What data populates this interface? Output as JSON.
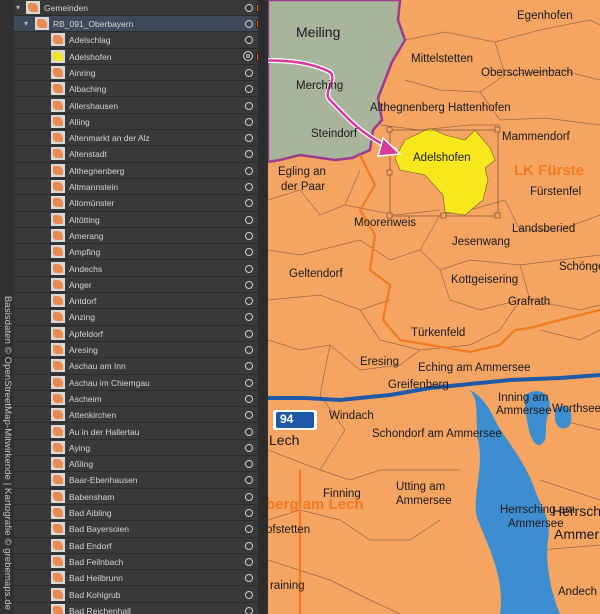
{
  "layers": {
    "root_label": "Gemeinden",
    "group_label": "RB_091_Oberbayern",
    "items": [
      {
        "label": "Adelschlag"
      },
      {
        "label": "Adelshofen",
        "highlight": true
      },
      {
        "label": "Ainring"
      },
      {
        "label": "Albaching"
      },
      {
        "label": "Allershausen"
      },
      {
        "label": "Alling"
      },
      {
        "label": "Altenmarkt an der Alz"
      },
      {
        "label": "Altenstadt"
      },
      {
        "label": "Althegnenberg"
      },
      {
        "label": "Altmannstein"
      },
      {
        "label": "Altomünster"
      },
      {
        "label": "Altötting"
      },
      {
        "label": "Amerang"
      },
      {
        "label": "Ampfing"
      },
      {
        "label": "Andechs"
      },
      {
        "label": "Anger"
      },
      {
        "label": "Antdorf"
      },
      {
        "label": "Anzing"
      },
      {
        "label": "Apfeldorf"
      },
      {
        "label": "Aresing"
      },
      {
        "label": "Aschau am Inn"
      },
      {
        "label": "Aschau im Chiemgau"
      },
      {
        "label": "Ascheim"
      },
      {
        "label": "Attenkirchen"
      },
      {
        "label": "Au in der Hallertau"
      },
      {
        "label": "Aying"
      },
      {
        "label": "Aßling"
      },
      {
        "label": "Baar-Ebenhausen"
      },
      {
        "label": "Babensham"
      },
      {
        "label": "Bad Aibling"
      },
      {
        "label": "Bad Bayersoien"
      },
      {
        "label": "Bad Endorf"
      },
      {
        "label": "Bad Feilnbach"
      },
      {
        "label": "Bad Heilbrunn"
      },
      {
        "label": "Bad Kohlgrub"
      },
      {
        "label": "Bad Reichenhall"
      }
    ]
  },
  "watermark": "Basisdaten © OpenStreetMap-Mitwirkende | Kartografie © grebemaps.de",
  "map": {
    "highway": "94",
    "places": {
      "egenhofen": "Egenhofen",
      "meiling": "Meiling",
      "mittelstetten": "Mittelstetten",
      "oberschweinbach": "Oberschweinbach",
      "merching": "Merching",
      "althegnenberg": "Althegnenberg",
      "hattenhofen": "Hattenhofen",
      "mammendorf": "Mammendorf",
      "steindorf": "Steindorf",
      "adelshofen": "Adelshofen",
      "egling": "Egling an",
      "egling2": "der Paar",
      "lk": "LK Fürste",
      "fuerstenfeld": "Fürstenfel",
      "moorenweis": "Moorenweis",
      "landsberied": "Landsberied",
      "jesenwang": "Jesenwang",
      "schoenge": "Schönge",
      "geltendorf": "Geltendorf",
      "kottgeisering": "Kottgeisering",
      "grafrath": "Grafrath",
      "tuerkenfeld": "Türkenfeld",
      "eching": "Eching am Ammersee",
      "eresing": "Eresing",
      "greifenberg": "Greifenberg",
      "inning": "Inning am",
      "inning2": "Ammersee",
      "worthsee": "Worthsee",
      "windach": "Windach",
      "lech": "Lech",
      "schondorf": "Schondorf am Ammersee",
      "utting": "Utting am",
      "utting2": "Ammersee",
      "finning": "Finning",
      "herrsching": "Herrsching am",
      "herrsching2": "Ammersee",
      "ammer": "Ammer",
      "herrsch": "Herrsch",
      "lkberg": "berg am Lech",
      "hofstetten": "ofstetten",
      "raining": "raining",
      "andech": "Andech"
    }
  }
}
